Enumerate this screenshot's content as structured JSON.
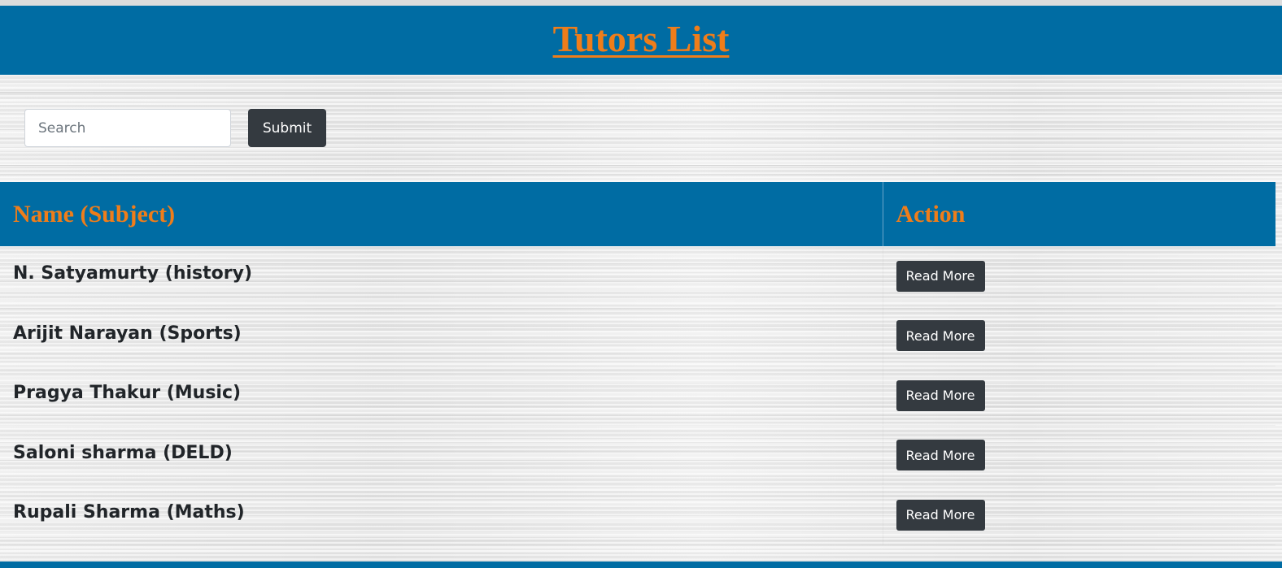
{
  "header": {
    "title": "Tutors List"
  },
  "search": {
    "placeholder": "Search",
    "value": "",
    "submit_label": "Submit"
  },
  "table": {
    "columns": [
      "Name (Subject)",
      "Action"
    ],
    "rows": [
      {
        "name": "N. Satyamurty (history)",
        "action_label": "Read More"
      },
      {
        "name": "Arijit Narayan (Sports)",
        "action_label": "Read More"
      },
      {
        "name": "Pragya Thakur (Music)",
        "action_label": "Read More"
      },
      {
        "name": "Saloni sharma (DELD)",
        "action_label": "Read More"
      },
      {
        "name": "Rupali Sharma (Maths)",
        "action_label": "Read More"
      }
    ]
  },
  "colors": {
    "banner": "#006ca3",
    "accent_text": "#ef7d1a",
    "button_dark": "#343a40",
    "body_text": "#212529"
  }
}
